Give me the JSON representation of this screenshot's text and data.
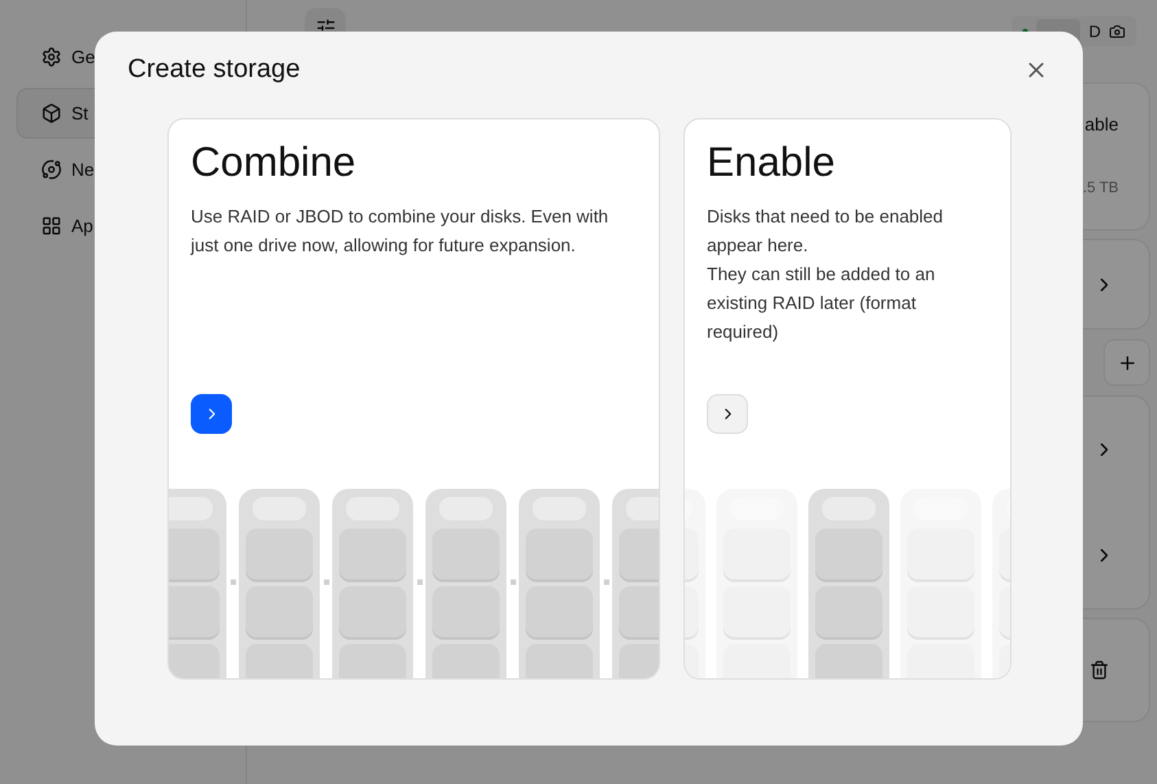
{
  "sidebar": {
    "items": [
      {
        "label": "Ge",
        "selected": false
      },
      {
        "label": "St",
        "selected": true
      },
      {
        "label": "Ne",
        "selected": false
      },
      {
        "label": "Ap",
        "selected": false
      }
    ]
  },
  "background": {
    "drive_label": "D",
    "pool_title": "able",
    "pool_size": ".5 TB"
  },
  "dialog": {
    "title": "Create storage",
    "cards": [
      {
        "kind": "combine",
        "title": "Combine",
        "description": [
          "Use RAID or JBOD to combine your disks. Even with just one drive now, allowing for future expansion."
        ],
        "primary": true
      },
      {
        "kind": "enable",
        "title": "Enable",
        "description": [
          "Disks that need to be enabled appear here.",
          "They can still be added to an existing RAID later (format required)"
        ],
        "primary": false
      }
    ]
  }
}
